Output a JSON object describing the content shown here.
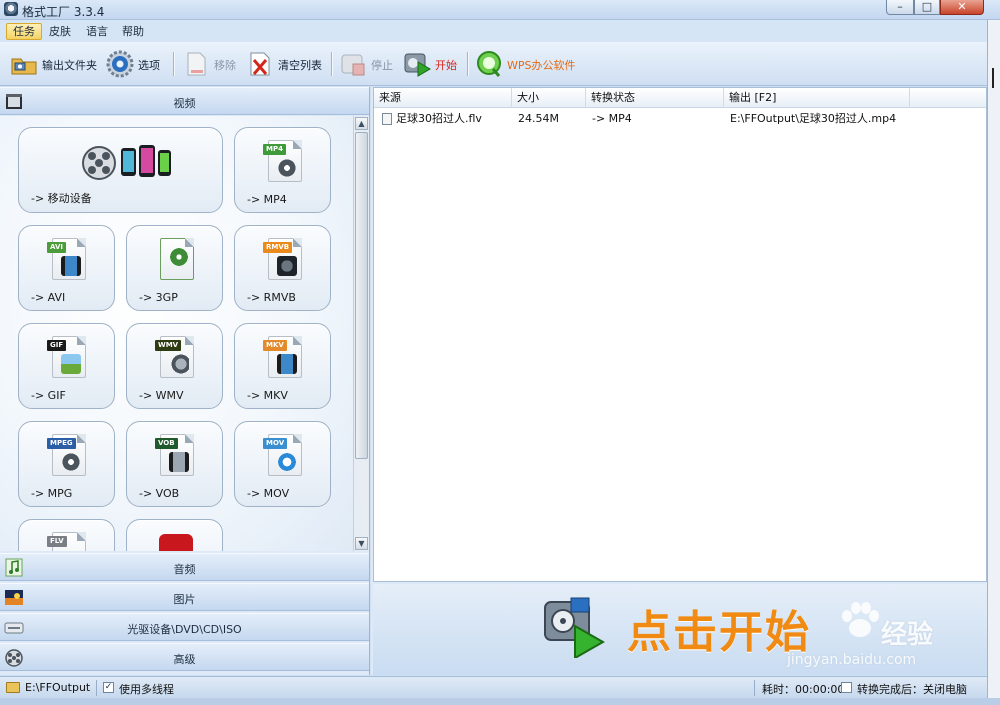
{
  "window": {
    "title": "格式工厂 3.3.4",
    "min": "–",
    "max": "□",
    "close": "✕"
  },
  "menu": [
    {
      "label": "任务",
      "active": true
    },
    {
      "label": "皮肤"
    },
    {
      "label": "语言"
    },
    {
      "label": "帮助"
    }
  ],
  "toolbar": {
    "output_folder": "输出文件夹",
    "options": "选项",
    "remove": "移除",
    "clear_list": "清空列表",
    "stop": "停止",
    "start": "开始",
    "wps": "WPS办公软件"
  },
  "categories": {
    "video": "视频",
    "audio": "音频",
    "picture": "图片",
    "rom": "光驱设备\\DVD\\CD\\ISO",
    "advanced": "高级"
  },
  "video_tiles": [
    {
      "label": "-> 移动设备",
      "icon": "mobile-device-icon"
    },
    {
      "label": "-> MP4",
      "tag": "MP4",
      "tag_color": "#3f9a3a",
      "icon": "mp4-file-icon"
    },
    {
      "label": "-> AVI",
      "tag": "AVI",
      "tag_color": "#4a9d3a",
      "icon": "avi-file-icon"
    },
    {
      "label": "-> 3GP",
      "tag": "",
      "icon": "3gp-file-icon"
    },
    {
      "label": "-> RMVB",
      "tag": "RMVB",
      "tag_color": "#e98a1b",
      "icon": "rmvb-file-icon"
    },
    {
      "label": "-> GIF",
      "tag": "GIF",
      "tag_color": "#1a1a1a",
      "icon": "gif-file-icon"
    },
    {
      "label": "-> WMV",
      "tag": "WMV",
      "tag_color": "#2e3a12",
      "icon": "wmv-file-icon"
    },
    {
      "label": "-> MKV",
      "tag": "MKV",
      "tag_color": "#e48a2a",
      "icon": "mkv-file-icon"
    },
    {
      "label": "-> MPG",
      "tag": "MPEG",
      "tag_color": "#2b5fa5",
      "icon": "mpg-file-icon"
    },
    {
      "label": "-> VOB",
      "tag": "VOB",
      "tag_color": "#1e5a2b",
      "icon": "vob-file-icon"
    },
    {
      "label": "-> MOV",
      "tag": "MOV",
      "tag_color": "#3a8fd0",
      "icon": "mov-file-icon"
    },
    {
      "label": "",
      "tag": "FLV",
      "tag_color": "#7a7f86",
      "icon": "flv-file-icon"
    },
    {
      "label": "",
      "tag": "",
      "icon": "swf-file-icon"
    }
  ],
  "file_list": {
    "headers": [
      "来源",
      "大小",
      "转换状态",
      "输出 [F2]"
    ],
    "rows": [
      {
        "source": "足球30招过人.flv",
        "size": "24.54M",
        "status": "-> MP4",
        "output": "E:\\FFOutput\\足球30招过人.mp4"
      }
    ]
  },
  "banner": {
    "start_text": "点击开始",
    "watermark": "Bai 经验",
    "watermark_brand": "经验",
    "watermark_url": "jingyan.baidu.com"
  },
  "status": {
    "output_path": "E:\\FFOutput",
    "multithread_label": "使用多线程",
    "multithread_checked": true,
    "elapsed": "耗时：00:00:00",
    "after_convert": "转换完成后：关闭电脑",
    "after_convert_checked": false
  },
  "colors": {
    "accent_orange": "#f18a12",
    "start_red": "#d8261b",
    "wps_orange": "#e46a14"
  }
}
